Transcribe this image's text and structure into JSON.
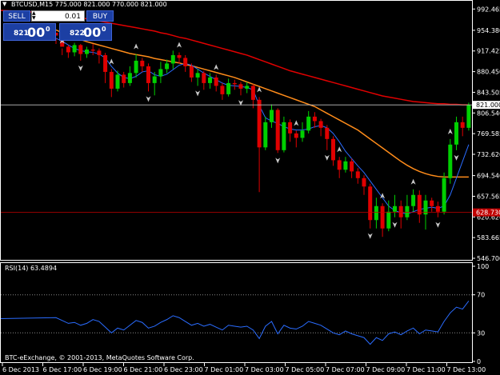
{
  "header": {
    "symbol_info": "BTCUSD,M15  775.000 821.000 770.000 821.000",
    "arrow_icon": "triangle-down-icon"
  },
  "trade_panel": {
    "sell_label": "SELL",
    "buy_label": "BUY",
    "lot_value": "0.01",
    "sell_price_small": "821",
    "sell_price_big": "00",
    "sell_price_sup": "0",
    "buy_price_small": "822",
    "buy_price_big": "00",
    "buy_price_sup": "0"
  },
  "price_axis": {
    "ticks": [
      "992.465",
      "954.380",
      "917.425",
      "880.450",
      "843.505",
      "806.540",
      "769.585",
      "732.620",
      "694.540",
      "657.565",
      "620.620",
      "583.665",
      "546.700"
    ],
    "current_price_label": "821.000",
    "line_price_label": "628.730",
    "current_price": 821.0,
    "horizontal_line_price": 628.73
  },
  "time_axis": {
    "labels": [
      "6 Dec 2013",
      "6 Dec 17:00",
      "6 Dec 19:00",
      "6 Dec 21:00",
      "6 Dec 23:00",
      "7 Dec 01:00",
      "7 Dec 03:00",
      "7 Dec 05:00",
      "7 Dec 07:00",
      "7 Dec 09:00",
      "7 Dec 11:00",
      "7 Dec 13:00"
    ]
  },
  "rsi": {
    "label": "RSI(14) 63.4894",
    "ticks": [
      "100",
      "70",
      "30",
      "0"
    ],
    "levels": [
      70,
      30
    ]
  },
  "footer": {
    "copyright": "BTC-eExchange, © 2001-2013, MetaQuotes Software Corp."
  },
  "colors": {
    "background": "#000000",
    "bull": "#00d000",
    "bear": "#e00000",
    "ma_slow": "#e00000",
    "ma_mid": "#ff8c1a",
    "ma_fast": "#2a6cff",
    "rsi_line": "#2a6cff",
    "panel_button": "#1c3fa3",
    "axis_text": "#ffffff"
  },
  "chart_data": {
    "type": "candlestick",
    "timeframe": "M15",
    "ylim": [
      546.7,
      1000
    ],
    "candles": [
      [
        950,
        945,
        940,
        930
      ],
      [
        945,
        925,
        922,
        910
      ],
      [
        925,
        915,
        928,
        905
      ],
      [
        915,
        928,
        932,
        908
      ],
      [
        928,
        912,
        930,
        900
      ],
      [
        912,
        920,
        925,
        905
      ],
      [
        920,
        918,
        930,
        910
      ],
      [
        918,
        910,
        922,
        895
      ],
      [
        910,
        880,
        914,
        860
      ],
      [
        880,
        850,
        885,
        835
      ],
      [
        850,
        875,
        882,
        845
      ],
      [
        875,
        860,
        880,
        852
      ],
      [
        860,
        878,
        890,
        855
      ],
      [
        878,
        900,
        912,
        870
      ],
      [
        900,
        890,
        905,
        880
      ],
      [
        890,
        860,
        895,
        845
      ],
      [
        860,
        872,
        880,
        838
      ],
      [
        872,
        885,
        898,
        860
      ],
      [
        885,
        895,
        902,
        878
      ],
      [
        895,
        910,
        918,
        885
      ],
      [
        910,
        905,
        915,
        895
      ],
      [
        905,
        890,
        910,
        880
      ],
      [
        890,
        870,
        895,
        862
      ],
      [
        870,
        878,
        885,
        855
      ],
      [
        878,
        860,
        882,
        848
      ],
      [
        860,
        870,
        878,
        850
      ],
      [
        870,
        855,
        875,
        845
      ],
      [
        855,
        840,
        860,
        830
      ],
      [
        840,
        860,
        868,
        836
      ],
      [
        860,
        858,
        866,
        848
      ],
      [
        858,
        850,
        862,
        838
      ],
      [
        850,
        855,
        862,
        842
      ],
      [
        855,
        830,
        858,
        815
      ],
      [
        830,
        745,
        835,
        665
      ],
      [
        745,
        790,
        800,
        740
      ],
      [
        790,
        812,
        822,
        780
      ],
      [
        812,
        740,
        815,
        735
      ],
      [
        740,
        790,
        800,
        736
      ],
      [
        790,
        770,
        795,
        755
      ],
      [
        770,
        762,
        775,
        745
      ],
      [
        762,
        775,
        790,
        755
      ],
      [
        775,
        800,
        810,
        770
      ],
      [
        800,
        792,
        808,
        780
      ],
      [
        792,
        780,
        796,
        765
      ],
      [
        780,
        760,
        785,
        740
      ],
      [
        760,
        722,
        765,
        712
      ],
      [
        722,
        705,
        728,
        690
      ],
      [
        705,
        720,
        728,
        700
      ],
      [
        720,
        702,
        725,
        690
      ],
      [
        702,
        690,
        708,
        680
      ],
      [
        690,
        675,
        695,
        660
      ],
      [
        675,
        615,
        680,
        600
      ],
      [
        615,
        640,
        655,
        600
      ],
      [
        640,
        600,
        645,
        585
      ],
      [
        600,
        630,
        650,
        595
      ],
      [
        630,
        640,
        660,
        620
      ],
      [
        640,
        620,
        650,
        600
      ],
      [
        620,
        640,
        660,
        615
      ],
      [
        640,
        660,
        670,
        630
      ],
      [
        660,
        625,
        668,
        610
      ],
      [
        625,
        650,
        660,
        598
      ],
      [
        650,
        640,
        655,
        630
      ],
      [
        640,
        630,
        648,
        620
      ],
      [
        630,
        690,
        700,
        625
      ],
      [
        690,
        750,
        760,
        680
      ],
      [
        750,
        790,
        800,
        740
      ],
      [
        790,
        780,
        800,
        765
      ],
      [
        780,
        821,
        825,
        775
      ]
    ],
    "ma_slow": [
      985,
      983,
      981,
      979,
      977,
      975,
      973,
      971,
      969,
      967,
      965,
      963,
      961,
      959,
      957,
      955,
      953,
      950,
      948,
      945,
      942,
      940,
      937,
      934,
      931,
      928,
      925,
      922,
      919,
      916,
      913,
      910,
      906,
      902,
      898,
      894,
      890,
      886,
      882,
      879,
      876,
      873,
      870,
      867,
      864,
      861,
      858,
      855,
      852,
      849,
      846,
      843,
      840,
      837,
      835,
      833,
      831,
      829,
      827,
      826,
      825,
      824,
      823,
      823,
      822,
      822,
      821,
      821
    ],
    "ma_mid": [
      955,
      950,
      946,
      942,
      938,
      934,
      931,
      928,
      925,
      922,
      919,
      916,
      913,
      911,
      909,
      907,
      904,
      902,
      900,
      898,
      896,
      893,
      891,
      888,
      885,
      882,
      879,
      876,
      873,
      870,
      866,
      862,
      858,
      854,
      850,
      846,
      842,
      838,
      834,
      830,
      826,
      822,
      818,
      812,
      806,
      800,
      794,
      788,
      782,
      776,
      768,
      760,
      752,
      744,
      736,
      728,
      720,
      713,
      707,
      702,
      698,
      695,
      693,
      692,
      692,
      692,
      692,
      692
    ],
    "ma_fast": [
      940,
      935,
      928,
      922,
      918,
      916,
      915,
      912,
      905,
      890,
      878,
      870,
      868,
      872,
      880,
      882,
      875,
      872,
      876,
      884,
      892,
      895,
      892,
      885,
      878,
      872,
      866,
      860,
      856,
      855,
      854,
      852,
      848,
      820,
      798,
      792,
      788,
      782,
      778,
      776,
      776,
      778,
      782,
      784,
      780,
      770,
      755,
      738,
      725,
      712,
      700,
      685,
      670,
      655,
      640,
      632,
      628,
      626,
      630,
      634,
      636,
      638,
      636,
      640,
      660,
      690,
      720,
      750
    ],
    "rsi_values": [
      46,
      43,
      40,
      41,
      38,
      40,
      44,
      42,
      36,
      30,
      35,
      33,
      38,
      43,
      41,
      35,
      37,
      41,
      44,
      48,
      46,
      42,
      38,
      40,
      37,
      39,
      36,
      33,
      38,
      37,
      36,
      37,
      33,
      24,
      37,
      42,
      29,
      38,
      35,
      34,
      37,
      42,
      40,
      38,
      34,
      30,
      28,
      32,
      29,
      27,
      25,
      18,
      25,
      22,
      29,
      31,
      28,
      32,
      35,
      29,
      33,
      32,
      31,
      42,
      51,
      57,
      55,
      63.4894
    ],
    "up_arrows_at": [
      1,
      9,
      13,
      20,
      26,
      33,
      39,
      46,
      53,
      58,
      64
    ],
    "down_arrows_at": [
      4,
      15,
      23,
      30,
      36,
      44,
      51,
      55,
      62,
      65
    ]
  }
}
